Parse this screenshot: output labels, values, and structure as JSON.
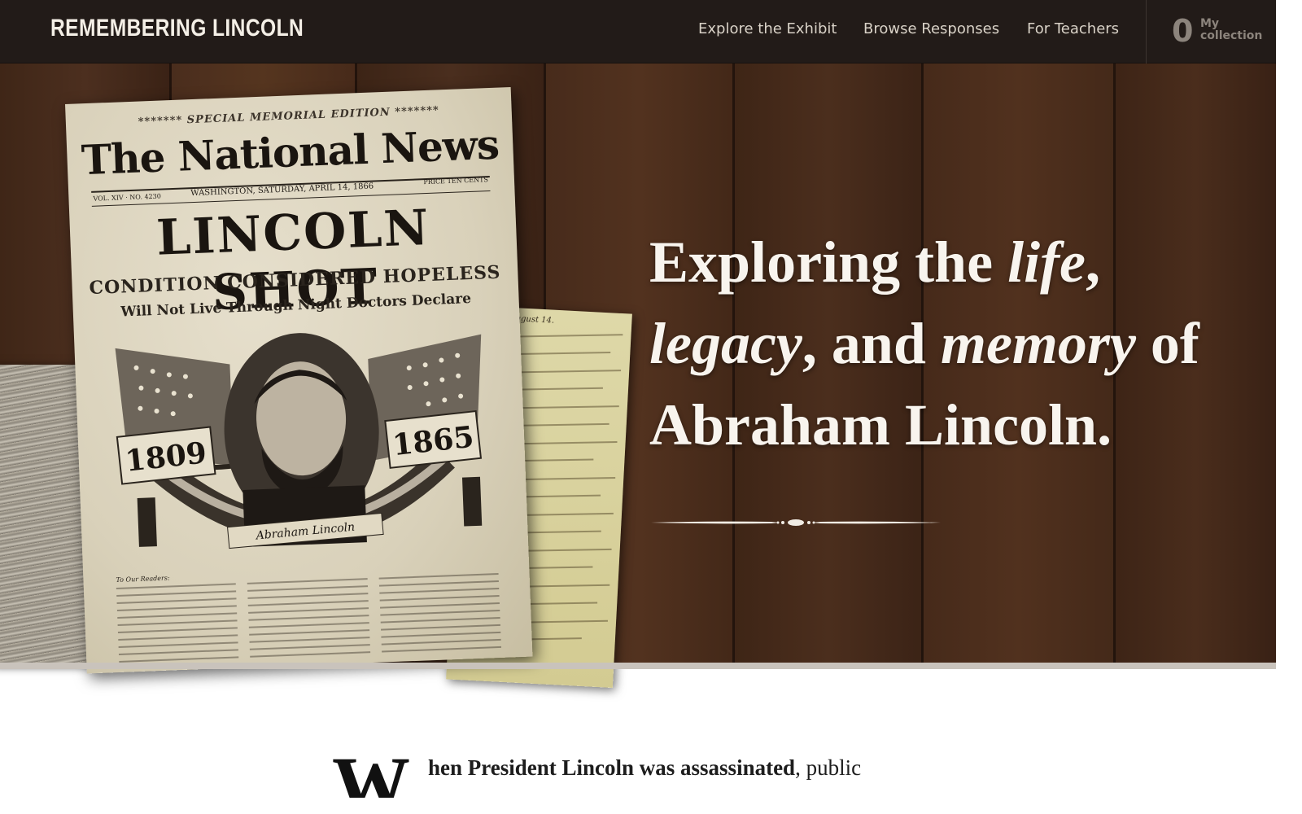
{
  "header": {
    "logo": "REMEMBERING LINCOLN",
    "nav": [
      {
        "label": "Explore the Exhibit"
      },
      {
        "label": "Browse Responses"
      },
      {
        "label": "For Teachers"
      }
    ],
    "collection": {
      "count": "0",
      "label_line1": "My",
      "label_line2": "collection"
    }
  },
  "hero": {
    "title_part1": "Exploring the ",
    "title_em1": "life",
    "title_part2": ", ",
    "title_em2": "legacy",
    "title_part3": ", and ",
    "title_em3": "memory",
    "title_part4": " of Abraham Lincoln.",
    "newspaper": {
      "edition": "******* SPECIAL MEMORIAL EDITION *******",
      "name": "The National News",
      "vol": "VOL. XIV · NO. 4230",
      "date": "WASHINGTON, SATURDAY, APRIL 14, 1866",
      "price": "PRICE TEN CENTS",
      "headline": "LINCOLN SHOT",
      "sub1": "CONDITION CONSIDERED HOPELESS",
      "sub2": "Will Not Live Through Night Doctors Declare",
      "year_left": "1809",
      "year_right": "1865",
      "signature": "Abraham Lincoln",
      "readers": "To Our Readers:"
    },
    "letter_heading": "August 14."
  },
  "intro": {
    "dropcap": "W",
    "bold": "hen President Lincoln was assassinated",
    "rest": ", public"
  }
}
